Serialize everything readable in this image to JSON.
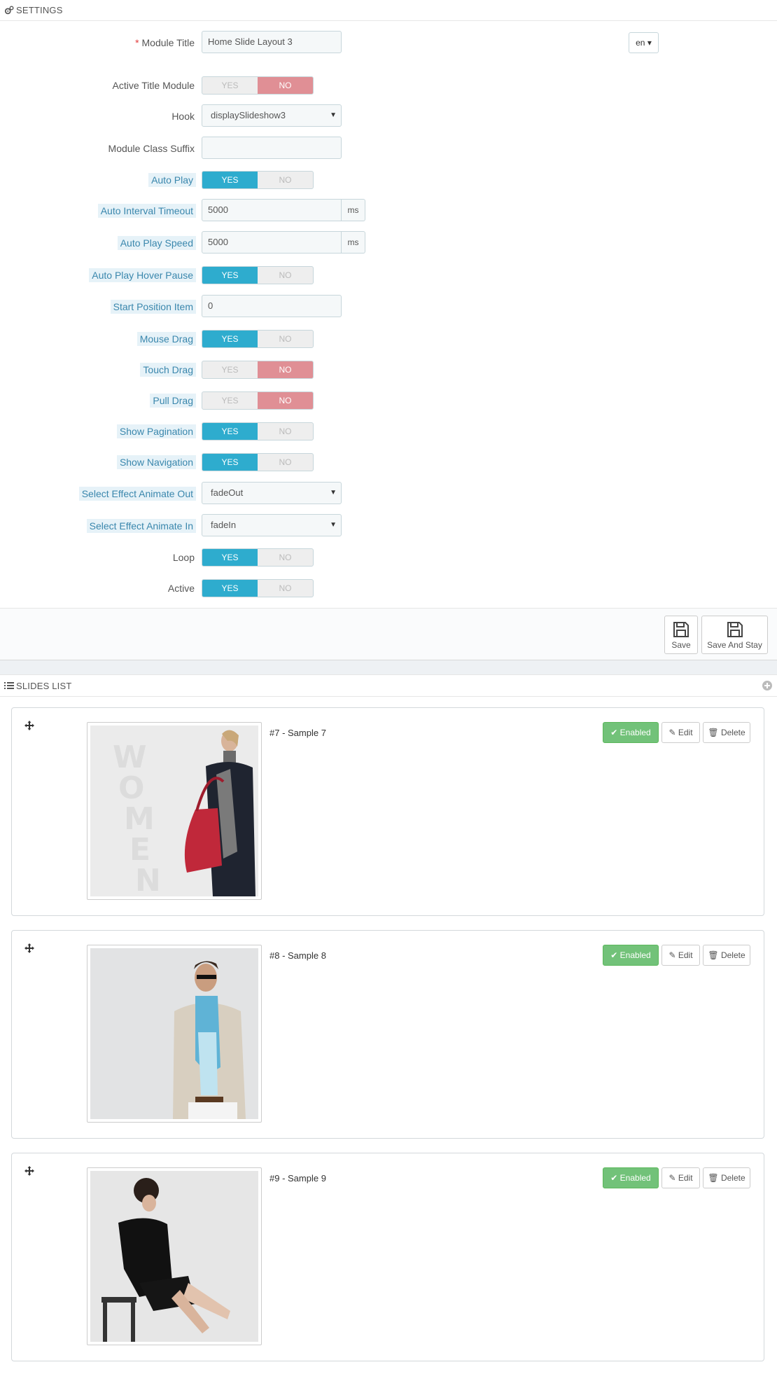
{
  "settings": {
    "heading": "SETTINGS",
    "lang": "en",
    "module_title": {
      "label": "Module Title",
      "required": "*",
      "value": "Home Slide Layout 3"
    },
    "active_title_module": {
      "label": "Active Title Module",
      "yes": "YES",
      "no": "NO",
      "selected": "no"
    },
    "hook": {
      "label": "Hook",
      "value": "displaySlideshow3"
    },
    "module_class_suffix": {
      "label": "Module Class Suffix",
      "value": ""
    },
    "auto_play": {
      "label": "Auto Play",
      "yes": "YES",
      "no": "NO",
      "selected": "yes"
    },
    "auto_interval_timeout": {
      "label": "Auto Interval Timeout",
      "value": "5000",
      "unit": "ms"
    },
    "auto_play_speed": {
      "label": "Auto Play Speed",
      "value": "5000",
      "unit": "ms"
    },
    "auto_play_hover_pause": {
      "label": "Auto Play Hover Pause",
      "yes": "YES",
      "no": "NO",
      "selected": "yes"
    },
    "start_position_item": {
      "label": "Start Position Item",
      "value": "0"
    },
    "mouse_drag": {
      "label": "Mouse Drag",
      "yes": "YES",
      "no": "NO",
      "selected": "yes"
    },
    "touch_drag": {
      "label": "Touch Drag",
      "yes": "YES",
      "no": "NO",
      "selected": "no"
    },
    "pull_drag": {
      "label": "Pull Drag",
      "yes": "YES",
      "no": "NO",
      "selected": "no"
    },
    "show_pagination": {
      "label": "Show Pagination",
      "yes": "YES",
      "no": "NO",
      "selected": "yes"
    },
    "show_navigation": {
      "label": "Show Navigation",
      "yes": "YES",
      "no": "NO",
      "selected": "yes"
    },
    "effect_animate_out": {
      "label": "Select Effect Animate Out",
      "value": "fadeOut"
    },
    "effect_animate_in": {
      "label": "Select Effect Animate In",
      "value": "fadeIn"
    },
    "loop": {
      "label": "Loop",
      "yes": "YES",
      "no": "NO",
      "selected": "yes"
    },
    "active": {
      "label": "Active",
      "yes": "YES",
      "no": "NO",
      "selected": "yes"
    },
    "save_label": "Save",
    "save_and_stay_label": "Save And Stay"
  },
  "slides": {
    "heading": "SLIDES LIST",
    "items": [
      {
        "title": "#7 - Sample 7",
        "status": "Enabled",
        "edit": "Edit",
        "delete": "Delete",
        "watermark": "WOMEN"
      },
      {
        "title": "#8 - Sample 8",
        "status": "Enabled",
        "edit": "Edit",
        "delete": "Delete"
      },
      {
        "title": "#9 - Sample 9",
        "status": "Enabled",
        "edit": "Edit",
        "delete": "Delete"
      }
    ]
  },
  "colors": {
    "accent_yes": "#2eacce",
    "accent_no": "#e08f95",
    "enabled_green": "#72c279",
    "help_label_bg": "#e6f2f8",
    "help_label_text": "#3a87ad"
  }
}
